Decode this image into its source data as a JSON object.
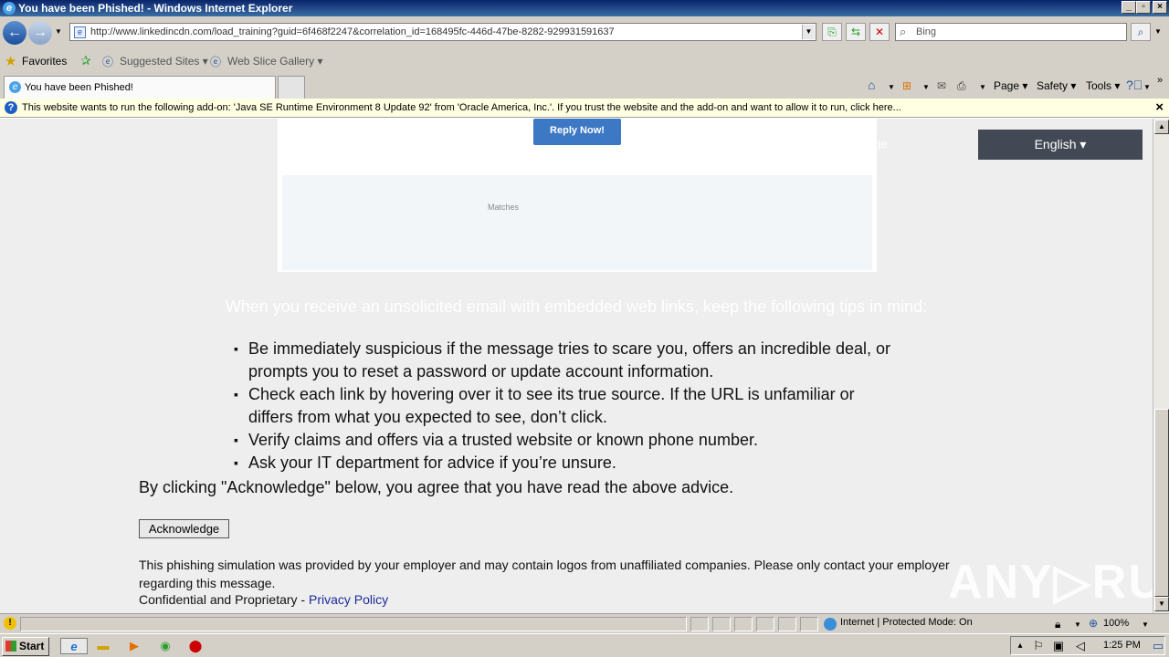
{
  "window": {
    "title": "You have been Phished! - Windows Internet Explorer"
  },
  "address_bar": {
    "url": "http://www.linkedincdn.com/load_training?guid=6f468f2247&correlation_id=168495fc-446d-47be-8282-929931591637",
    "search_placeholder": "Bing"
  },
  "favorites_bar": {
    "favorites_label": "Favorites",
    "suggested_sites": "Suggested Sites",
    "web_slice_gallery": "Web Slice Gallery"
  },
  "tabs": [
    {
      "label": "You have been Phished!"
    }
  ],
  "command_bar": {
    "page": "Page",
    "safety": "Safety",
    "tools": "Tools"
  },
  "info_bar": {
    "text": "This website wants to run the following add-on: 'Java SE Runtime Environment 8 Update 92' from 'Oracle America, Inc.'. If you trust the website and the add-on and want to allow it to run, click here..."
  },
  "page": {
    "reply_button": "Reply Now!",
    "matches_label": "Matches",
    "ghost_text": "age",
    "language_button": "English ▾",
    "tips_heading": "When you receive an unsolicited email with embedded web links, keep the following tips in mind:",
    "tips": [
      "Be immediately suspicious if the message tries to scare you, offers an incredible deal, or prompts you to reset a password or update account information.",
      "Check each link by hovering over it to see its true source. If the URL is unfamiliar or differs from what you expected to see, don’t click.",
      "Verify claims and offers via a trusted website or known phone number.",
      "Ask your IT department for advice if you’re unsure."
    ],
    "agree_text": "By clicking \"Acknowledge\" below, you agree that you have read the above advice.",
    "acknowledge_button": "Acknowledge",
    "disclaimer": "This phishing simulation was provided by your employer and may contain logos from unaffiliated companies. Please only contact your employer regarding this message.",
    "confidential": "Confidential and Proprietary - ",
    "privacy_policy": "Privacy Policy",
    "watermark": "ANY▷RUN"
  },
  "status_bar": {
    "zone": "Internet | Protected Mode: On",
    "zoom": "100%"
  },
  "taskbar": {
    "start": "Start",
    "clock": "1:25 PM"
  },
  "colors": {
    "accent_button": "#3d78c4",
    "language_button_bg": "#424954",
    "link": "#1a2b99"
  }
}
